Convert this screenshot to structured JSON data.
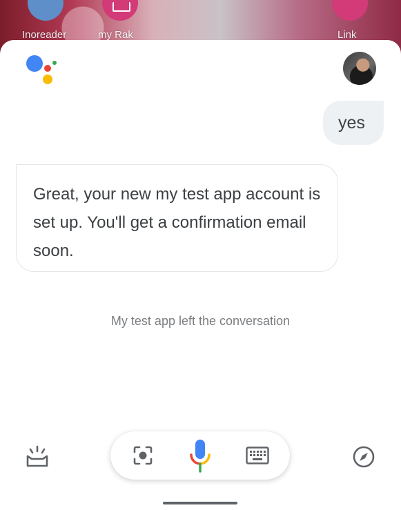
{
  "background": {
    "apps": [
      {
        "label": "Inoreader"
      },
      {
        "label": "my Rak"
      },
      {
        "label": "Link"
      }
    ]
  },
  "conversation": {
    "user_message": "yes",
    "assistant_message": "Great, your new my test app account is set up. You'll get a confirmation email soon.",
    "status": "My test app left the conversation"
  },
  "icons": {
    "assistant": "google-assistant-logo",
    "snapshot": "snapshot-icon",
    "lens": "lens-icon",
    "mic": "mic-icon",
    "keyboard": "keyboard-icon",
    "explore": "compass-icon"
  },
  "colors": {
    "google_blue": "#4285F4",
    "google_red": "#EA4335",
    "google_yellow": "#FBBC05",
    "google_green": "#34A853"
  }
}
